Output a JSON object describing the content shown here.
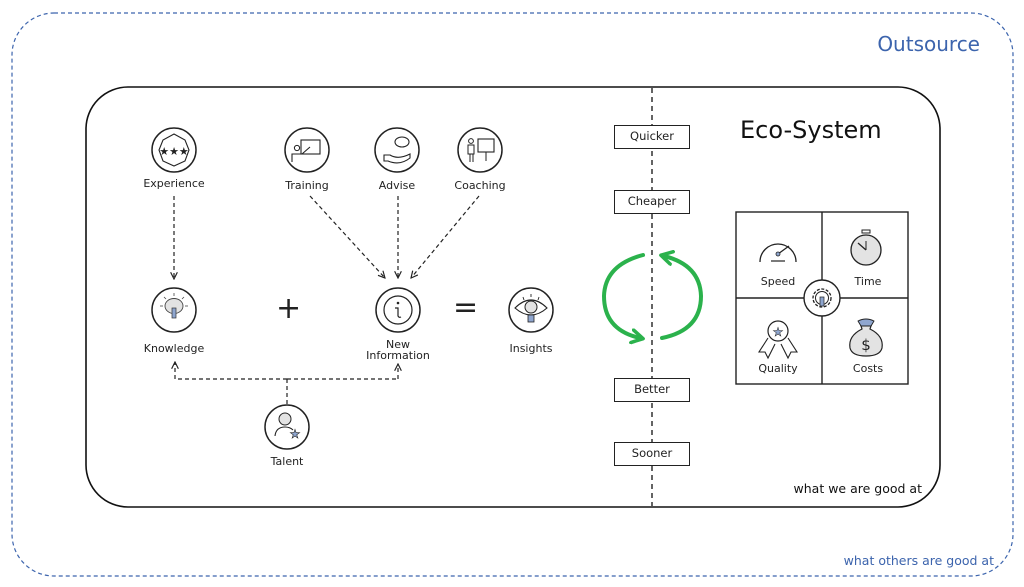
{
  "outsource": {
    "title": "Outsource",
    "footer": "what others are good at",
    "border_color": "#3c64ad"
  },
  "ecosystem": {
    "title": "Eco-System",
    "footer": "what we are good at"
  },
  "nodes": {
    "experience": {
      "label": "Experience",
      "icon": "stars-badge-icon"
    },
    "training": {
      "label": "Training",
      "icon": "teacher-board-icon"
    },
    "advise": {
      "label": "Advise",
      "icon": "hand-speech-bubble-icon"
    },
    "coaching": {
      "label": "Coaching",
      "icon": "presenter-easel-icon"
    },
    "knowledge": {
      "label": "Knowledge",
      "icon": "brain-lightbulb-icon"
    },
    "new_information_line1": "New",
    "new_information_line2": "Information",
    "new_information_icon": "info-icon",
    "insights": {
      "label": "Insights",
      "icon": "eye-magnifier-icon"
    },
    "talent": {
      "label": "Talent",
      "icon": "person-star-icon"
    }
  },
  "operators": {
    "plus": "+",
    "equals": "="
  },
  "benefits": [
    "Quicker",
    "Cheaper",
    "Better",
    "Sooner"
  ],
  "cycle_color": "#2bb24c",
  "quadrants": {
    "speed": {
      "label": "Speed",
      "icon": "speedometer-icon"
    },
    "time": {
      "label": "Time",
      "icon": "stopwatch-icon"
    },
    "quality": {
      "label": "Quality",
      "icon": "award-ribbon-icon"
    },
    "costs": {
      "label": "Costs",
      "icon": "money-bag-icon"
    },
    "center_icon": "gear-wrench-icon"
  },
  "accent_fill": "#8fa6cf"
}
